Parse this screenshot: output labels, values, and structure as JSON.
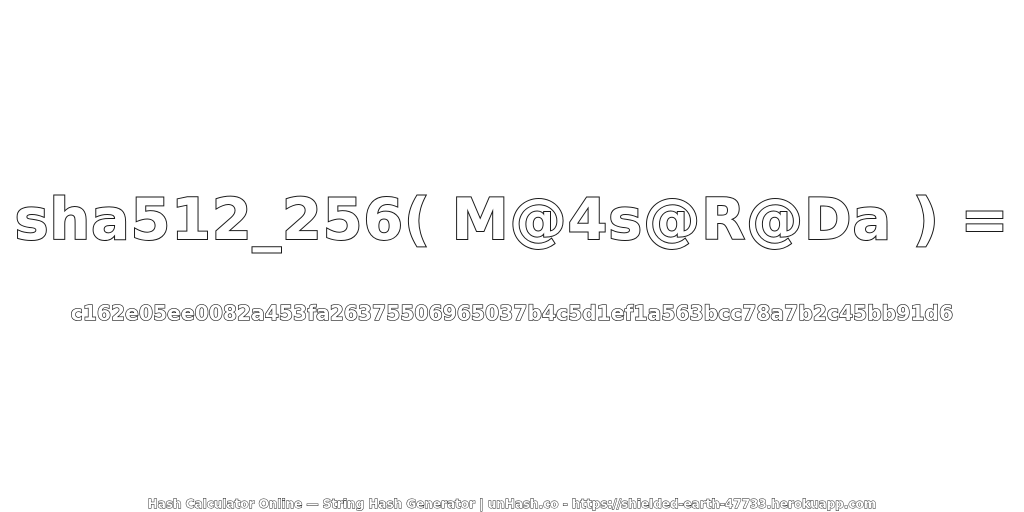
{
  "heading": "sha512_256( M@4s@R@Da ) =",
  "hash_value": "c162e05ee0082a453fa26375506965037b4c5d1ef1a563bcc78a7b2c45bb91d6",
  "footer": "Hash Calculator Online — String Hash Generator | unHash.co - https://shielded-earth-47733.herokuapp.com",
  "colors": {
    "background": "#ffffff",
    "text_fill": "#ffffff",
    "text_outline": "#1a1a1a"
  }
}
